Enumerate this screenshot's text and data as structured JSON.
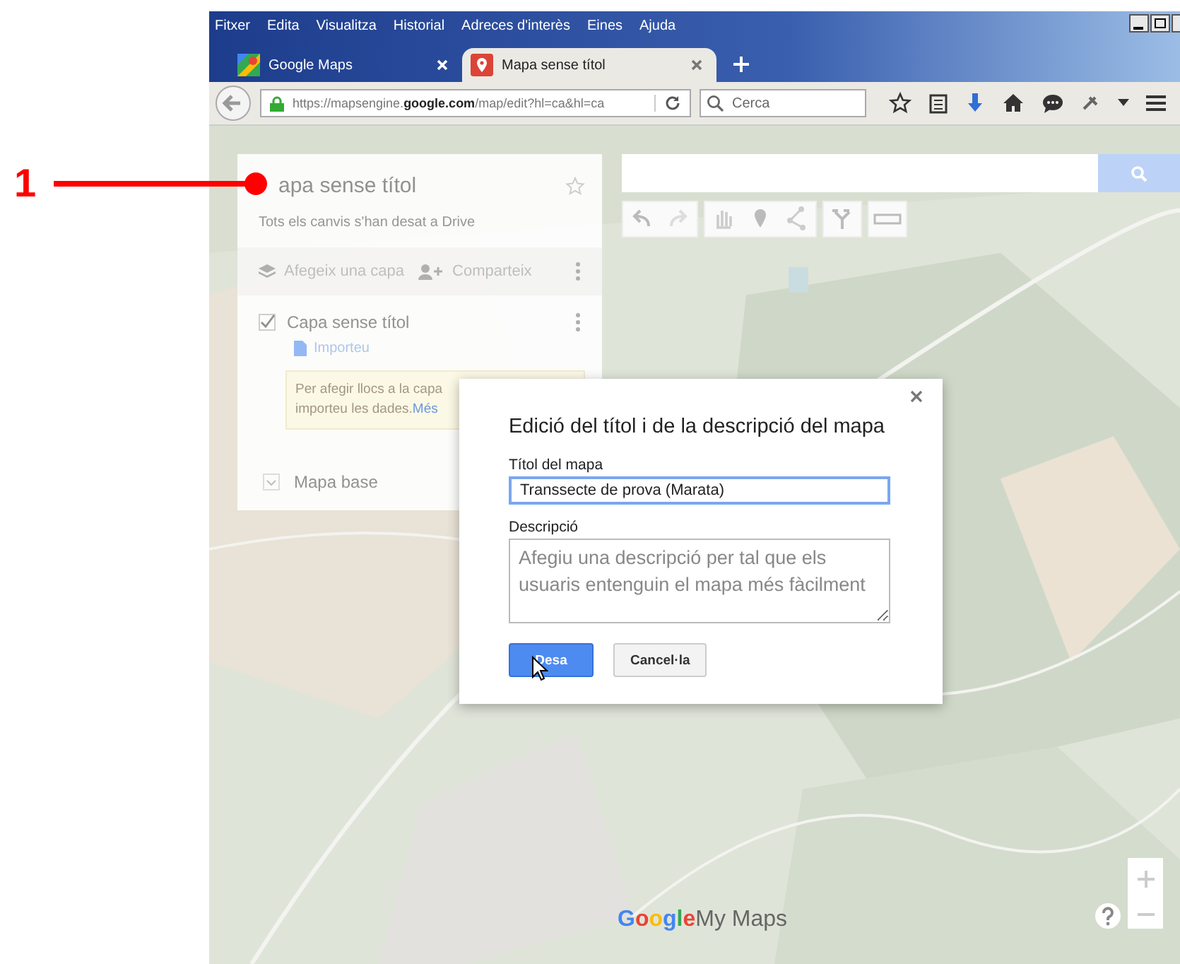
{
  "callout": {
    "number": "1"
  },
  "browser": {
    "menu": [
      "Fitxer",
      "Edita",
      "Visualitza",
      "Historial",
      "Adreces d'interès",
      "Eines",
      "Ajuda"
    ],
    "tabs": [
      {
        "title": "Google Maps",
        "selected": false
      },
      {
        "title": "Mapa sense títol",
        "selected": true
      }
    ],
    "address": "https://mapsengine.**google.com**/map/edit?hl=ca&hl=ca",
    "search_placeholder": "Cerca"
  },
  "map_panel": {
    "title": "apa sense títol",
    "status": "Tots els canvis s'han desat a Drive",
    "actions": [
      "Afegeix una capa",
      "Comparteix"
    ],
    "layer": {
      "name": "Capa sense títol",
      "checked": true,
      "import_link": "Importeu",
      "tip_lines": [
        "Per afegir llocs a la capa",
        "importeu les dades."
      ],
      "tip_link": "Més"
    },
    "base_map": "Mapa base"
  },
  "dialog": {
    "title": "Edició del títol i de la descripció del mapa",
    "fields": [
      {
        "label": "Títol del mapa",
        "kind": "input",
        "value": "Transsecte de prova (Marata)",
        "focused": true
      },
      {
        "label": "Descripció",
        "kind": "textarea",
        "placeholder": "Afegiu una descripció per tal que els usuaris entenguin el mapa més fàcilment",
        "focused": false
      }
    ],
    "buttons": [
      {
        "label": "Desa",
        "kind": "primary"
      },
      {
        "label": "Cancel·la",
        "kind": "secondary"
      }
    ]
  },
  "logo": {
    "brand": "Google",
    "product": "My Maps"
  }
}
